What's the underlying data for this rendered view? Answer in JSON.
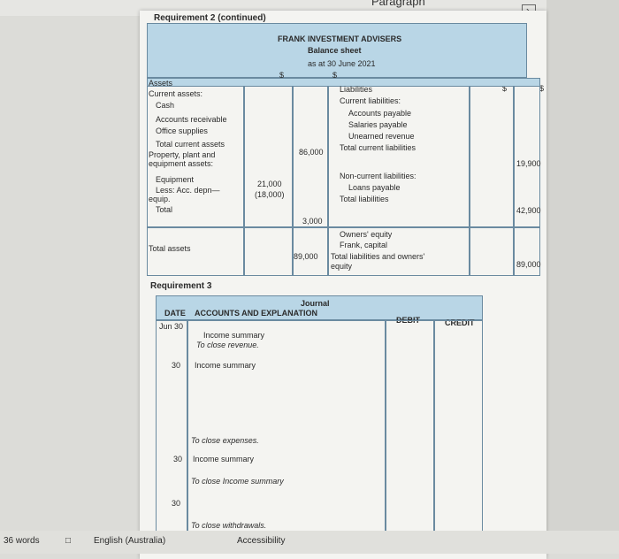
{
  "top": {
    "paragraph_label": "Paragraph"
  },
  "req2": {
    "title": "Requirement 2 (continued)",
    "company": "FRANK INVESTMENT ADVISERS",
    "statement": "Balance sheet",
    "date": "as at 30 June 2021",
    "currency": "$",
    "left": [
      "Assets",
      "Current assets:",
      "Cash",
      "Accounts receivable",
      "Office supplies",
      "Total current assets",
      "Property, plant and",
      "equipment assets:",
      "Equipment",
      "Less: Acc. depn—",
      "equip.",
      "Total",
      "Total assets"
    ],
    "left_values": {
      "total_current_assets": "86,000",
      "equipment": "21,000",
      "acc_depn": "(18,000)",
      "total_ppe": "3,000",
      "total_assets": "89,000"
    },
    "right": [
      "Liabilities",
      "Current liabilities:",
      "Accounts payable",
      "Salaries payable",
      "Unearned revenue",
      "Total current liabilities",
      "Non-current liabilities:",
      "Loans payable",
      "Total liabilities",
      "Owners' equity",
      "Frank, capital",
      "Total liabilities and owners'",
      "equity"
    ],
    "right_values": {
      "total_current_liabilities": "19,900",
      "total_liabilities": "42,900",
      "total_liab_equity": "89,000"
    }
  },
  "req3": {
    "title": "Requirement 3",
    "journal_title": "Journal",
    "headers": {
      "date": "DATE",
      "accounts": "ACCOUNTS AND EXPLANATION",
      "debit": "DEBIT",
      "credit": "CREDIT"
    },
    "rows": [
      {
        "date": "Jun 30",
        "text": ""
      },
      {
        "date": "",
        "text": "Income summary"
      },
      {
        "date": "",
        "text": "To close revenue."
      },
      {
        "date": "30",
        "text": "Income summary"
      },
      {
        "date": "",
        "text": "To close expenses."
      },
      {
        "date": "30",
        "text": "Income summary"
      },
      {
        "date": "",
        "text": "To close Income summary"
      },
      {
        "date": "30",
        "text": ""
      },
      {
        "date": "",
        "text": "To close withdrawals."
      }
    ]
  },
  "status": {
    "words": "36 words",
    "language": "English (Australia)",
    "accessibility": "Accessibility"
  }
}
